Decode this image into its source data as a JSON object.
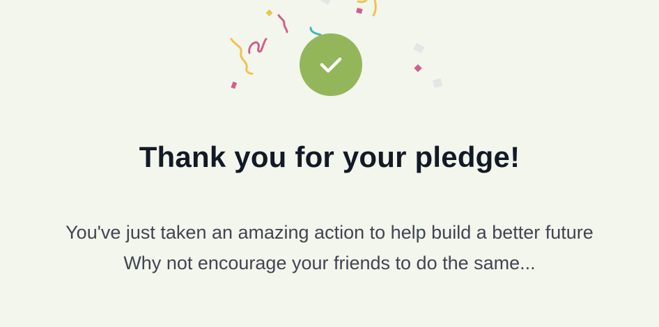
{
  "colors": {
    "background": "#f3f6ec",
    "success": "#93b65a",
    "title": "#121a26",
    "text": "#3f4553",
    "confetti_pink": "#d35d8d",
    "confetti_yellow": "#f2c24c",
    "confetti_teal": "#3fb7b8",
    "confetti_grey": "#e4e6e6"
  },
  "icons": {
    "success": "checkmark-icon"
  },
  "confirmation": {
    "title": "Thank you for your pledge!",
    "message_line1": "You've just taken an amazing action to help build a better future",
    "message_line2": "Why not encourage your friends to do the same..."
  }
}
